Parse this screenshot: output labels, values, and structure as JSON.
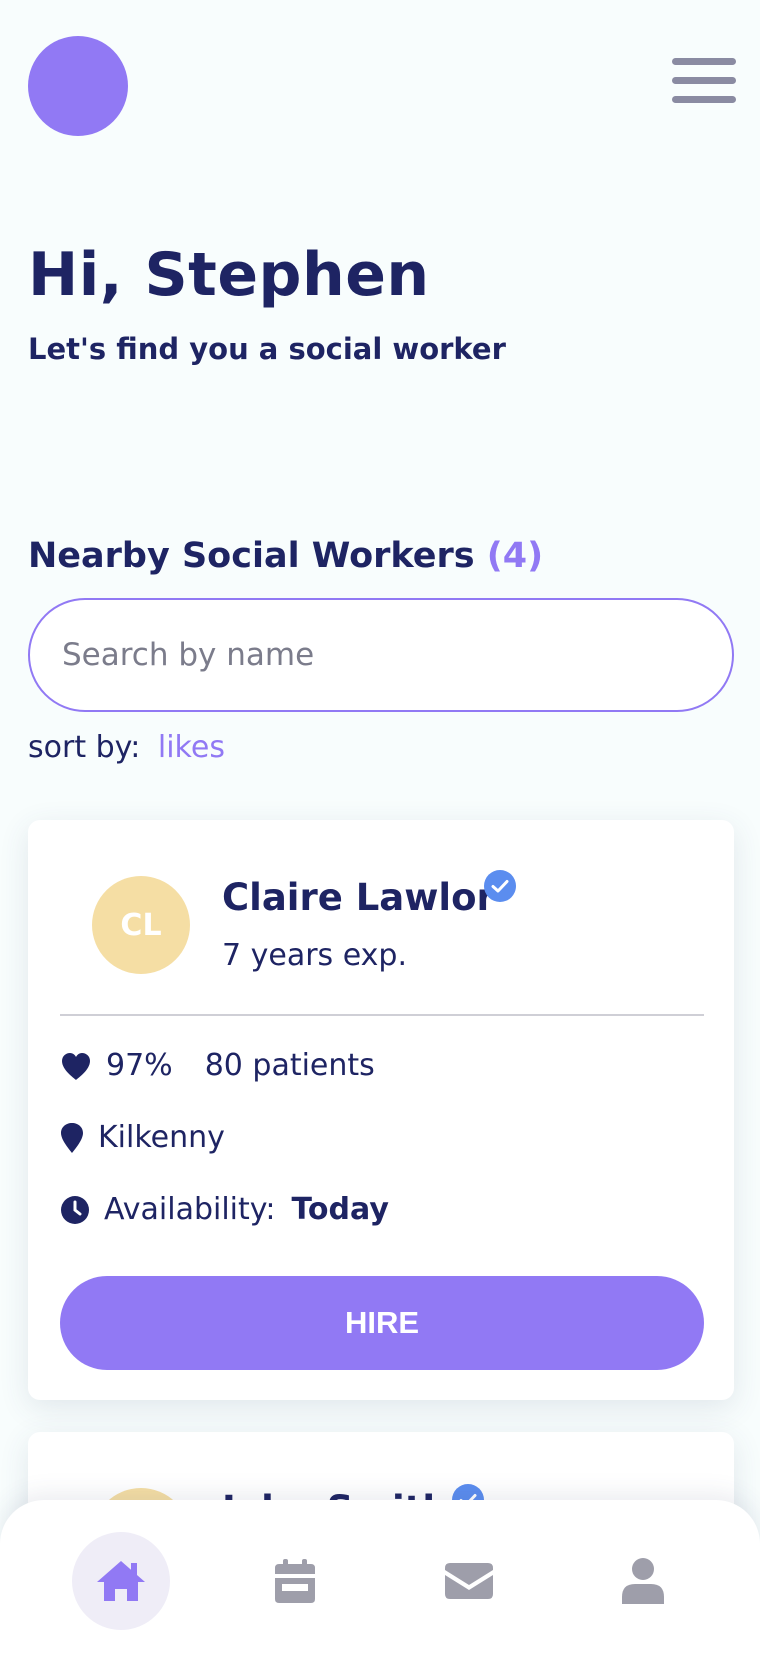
{
  "header": {
    "greeting": "Hi, Stephen",
    "subtitle": "Let's find you a social worker"
  },
  "section": {
    "title": "Nearby Social Workers",
    "count": "(4)"
  },
  "search": {
    "placeholder": "Search by name",
    "value": ""
  },
  "sort": {
    "label": "sort by:",
    "value": "likes"
  },
  "workers": [
    {
      "initials": "CL",
      "name": "Claire Lawlor",
      "experience": "7 years exp.",
      "rating": "97%",
      "patients": "80 patients",
      "location": "Kilkenny",
      "availability_label": "Availability:",
      "availability_value": "Today",
      "hire_label": "HIRE"
    },
    {
      "name": "John Smith"
    }
  ],
  "colors": {
    "primary": "#9179f4",
    "text": "#1e2463",
    "avatar_bg": "#f5dea4",
    "verified": "#5b8def",
    "background": "#f8fdfd",
    "nav_icon": "#9e9eaa"
  },
  "icons": {
    "menu": "hamburger-icon",
    "rating": "heart-icon",
    "location": "map-pin-icon",
    "availability": "clock-icon",
    "verified": "verified-badge-icon",
    "nav": [
      "home-icon",
      "calendar-icon",
      "envelope-icon",
      "user-icon"
    ]
  },
  "nav": {
    "active": "home"
  }
}
